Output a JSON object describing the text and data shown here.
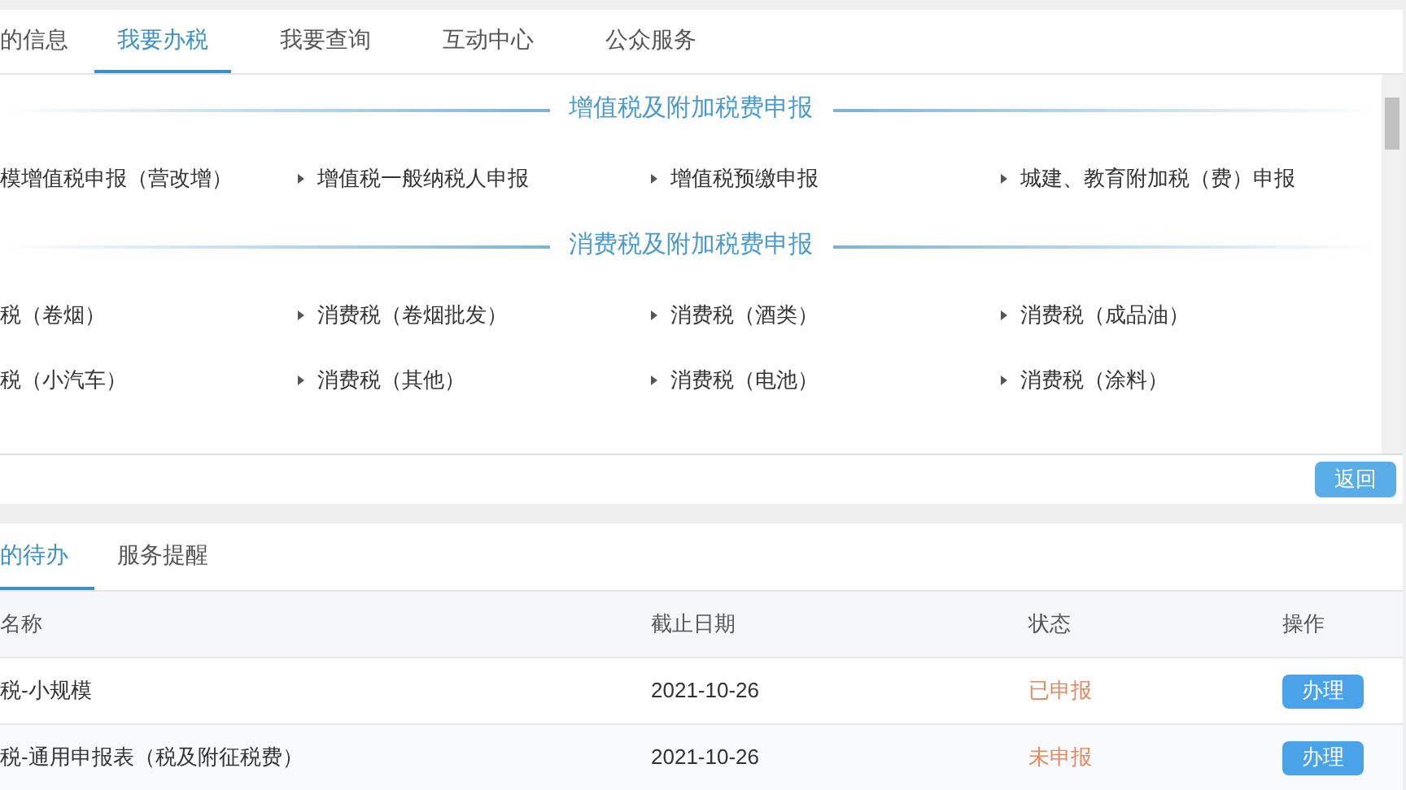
{
  "tabs": [
    {
      "label": "的信息",
      "selected": false
    },
    {
      "label": "我要办税",
      "selected": true
    },
    {
      "label": "我要查询",
      "selected": false
    },
    {
      "label": "互动中心",
      "selected": false
    },
    {
      "label": "公众服务",
      "selected": false
    }
  ],
  "sections": [
    {
      "title": "增值税及附加税费申报",
      "items": [
        "模增值税申报（营改增）",
        "增值税一般纳税人申报",
        "增值税预缴申报",
        "城建、教育附加税（费）申报"
      ]
    },
    {
      "title": "消费税及附加税费申报",
      "items": [
        "税（卷烟）",
        "消费税（卷烟批发）",
        "消费税（酒类）",
        "消费税（成品油）",
        "税（小汽车）",
        "消费税（其他）",
        "消费税（电池）",
        "消费税（涂料）"
      ]
    }
  ],
  "back_button": "返回",
  "bottom_tabs": [
    {
      "label": "的待办",
      "selected": true
    },
    {
      "label": "服务提醒",
      "selected": false
    }
  ],
  "table": {
    "columns": [
      "名称",
      "截止日期",
      "状态",
      "操作"
    ],
    "rows": [
      {
        "name": "税-小规模",
        "deadline": "2021-10-26",
        "status": "已申报",
        "action": "办理"
      },
      {
        "name": "税-通用申报表（税及附征税费）",
        "deadline": "2021-10-26",
        "status": "未申报",
        "action": "办理"
      }
    ]
  }
}
